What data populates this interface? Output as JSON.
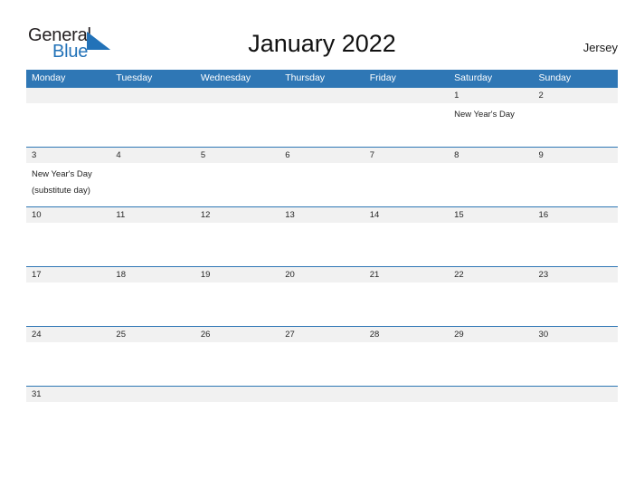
{
  "brand": {
    "word_one": "General",
    "word_two": "Blue",
    "flag_icon": "blue-triangle-flag-icon",
    "accent_color": "#2272b8"
  },
  "header": {
    "title": "January 2022",
    "location": "Jersey"
  },
  "theme": {
    "header_blue": "#2f77b5",
    "row_gray": "#f1f1f1",
    "rule_blue": "#2f77b5",
    "text_dark": "#262626"
  },
  "calendar": {
    "month": "January",
    "year": "2022",
    "weekday_headers": [
      "Monday",
      "Tuesday",
      "Wednesday",
      "Thursday",
      "Friday",
      "Saturday",
      "Sunday"
    ],
    "weeks": [
      {
        "dates": [
          "",
          "",
          "",
          "",
          "",
          "1",
          "2"
        ],
        "events": [
          "",
          "",
          "",
          "",
          "",
          "New Year's Day",
          ""
        ]
      },
      {
        "dates": [
          "3",
          "4",
          "5",
          "6",
          "7",
          "8",
          "9"
        ],
        "events": [
          "New Year's Day\n(substitute day)",
          "",
          "",
          "",
          "",
          "",
          ""
        ]
      },
      {
        "dates": [
          "10",
          "11",
          "12",
          "13",
          "14",
          "15",
          "16"
        ],
        "events": [
          "",
          "",
          "",
          "",
          "",
          "",
          ""
        ]
      },
      {
        "dates": [
          "17",
          "18",
          "19",
          "20",
          "21",
          "22",
          "23"
        ],
        "events": [
          "",
          "",
          "",
          "",
          "",
          "",
          ""
        ]
      },
      {
        "dates": [
          "24",
          "25",
          "26",
          "27",
          "28",
          "29",
          "30"
        ],
        "events": [
          "",
          "",
          "",
          "",
          "",
          "",
          ""
        ]
      },
      {
        "dates": [
          "31",
          "",
          "",
          "",
          "",
          "",
          ""
        ],
        "events": [
          "",
          "",
          "",
          "",
          "",
          "",
          ""
        ],
        "short": true
      }
    ]
  }
}
